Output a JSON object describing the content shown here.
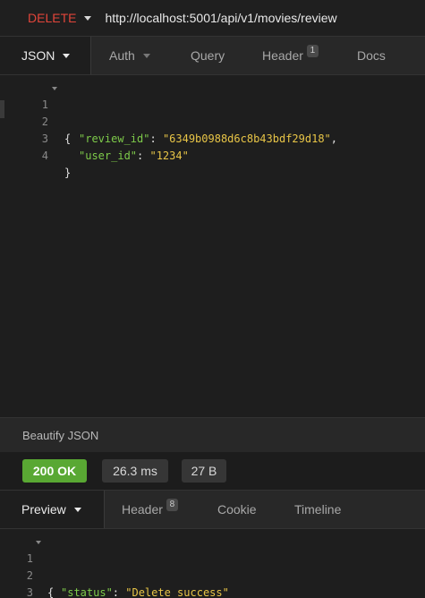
{
  "request": {
    "method": "DELETE",
    "url": "http://localhost:5001/api/v1/movies/review",
    "tabs": [
      {
        "label": "JSON"
      },
      {
        "label": "Auth"
      },
      {
        "label": "Query"
      },
      {
        "label": "Header",
        "badge": "1"
      },
      {
        "label": "Docs"
      }
    ],
    "body_lines": [
      {
        "n": "1",
        "text": "{"
      },
      {
        "n": "2",
        "key": "\"review_id\"",
        "value": "\"6349b0988d6c8b43bdf29d18\""
      },
      {
        "n": "3",
        "key": "\"user_id\"",
        "value": "\"1234\""
      },
      {
        "n": "4",
        "text": "}"
      }
    ],
    "beautify_label": "Beautify JSON"
  },
  "response": {
    "status": "200 OK",
    "time": "26.3 ms",
    "size": "27 B",
    "tabs": [
      {
        "label": "Preview"
      },
      {
        "label": "Header",
        "badge": "8"
      },
      {
        "label": "Cookie"
      },
      {
        "label": "Timeline"
      }
    ],
    "body_lines": [
      {
        "n": "1",
        "text": "{"
      },
      {
        "n": "2",
        "key": "\"status\"",
        "value": "\"Delete success\""
      },
      {
        "n": "3",
        "text": "}"
      }
    ]
  },
  "colors": {
    "method": "#e2453a",
    "status_ok": "#59a833",
    "json_key": "#7ecb4a",
    "json_string": "#e8c547"
  }
}
